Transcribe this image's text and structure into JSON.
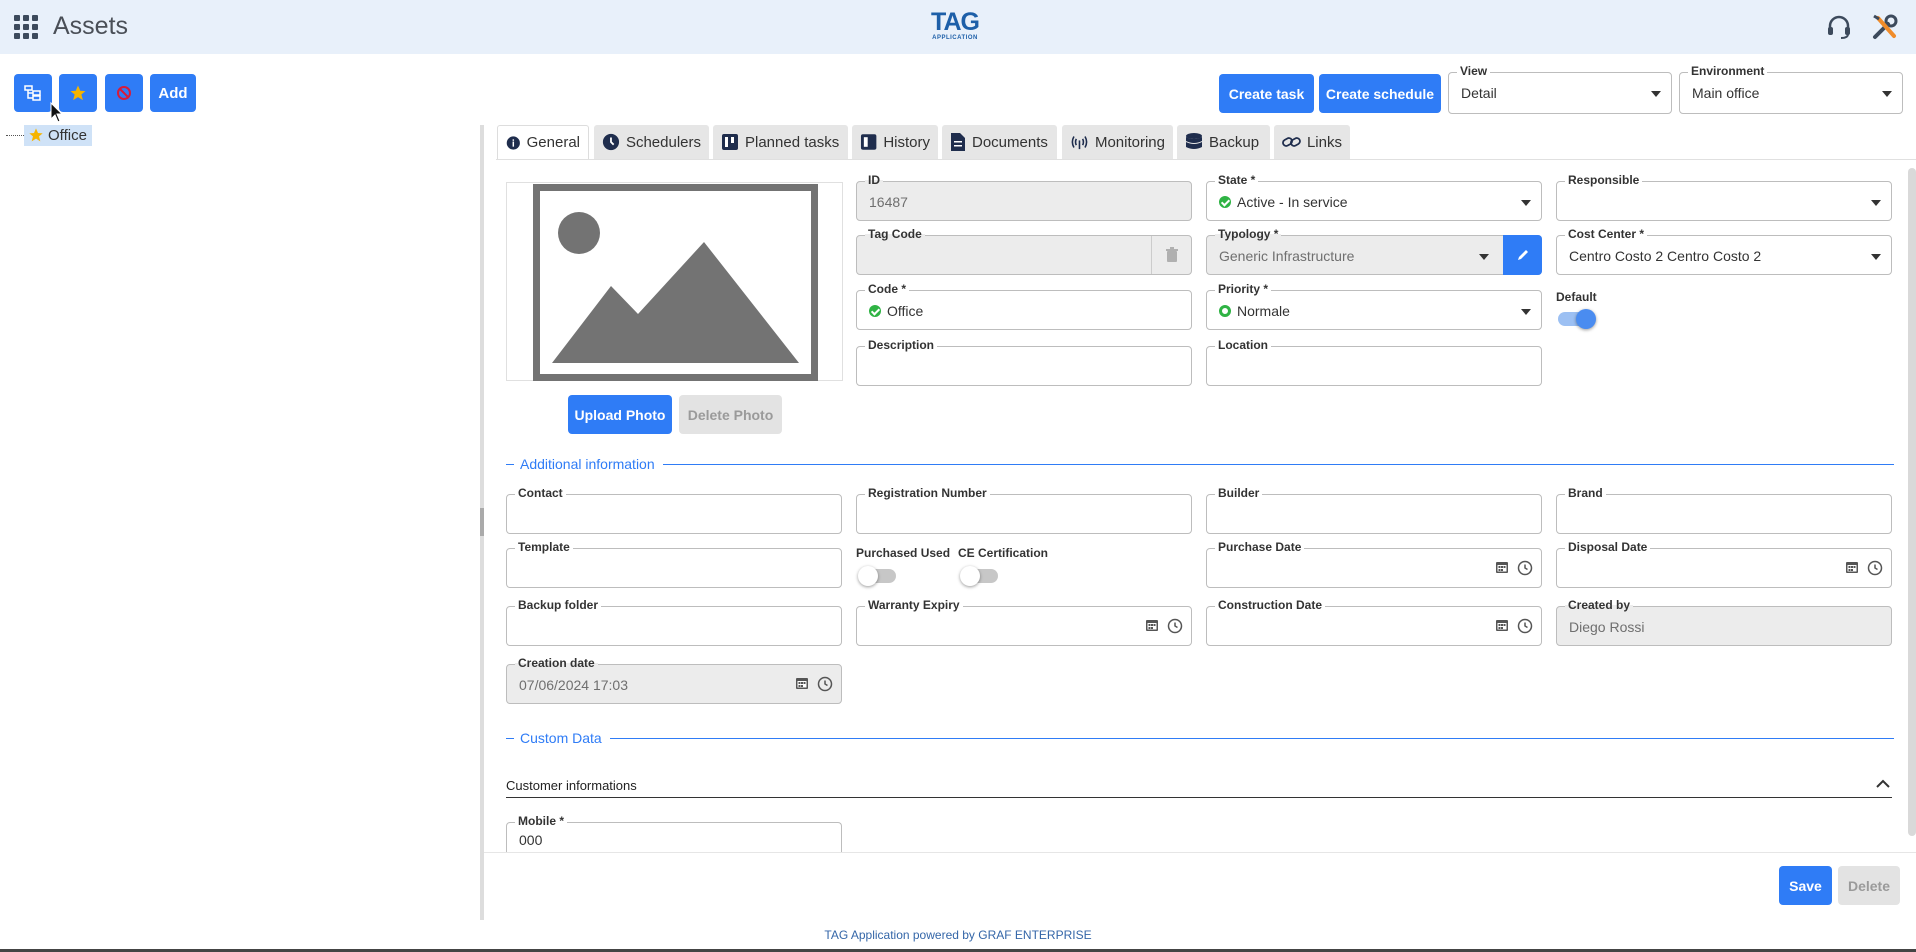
{
  "header": {
    "title": "Assets",
    "logo_big": "TAG",
    "logo_small": "APPLICATION"
  },
  "left_toolbar": {
    "add_label": "Add"
  },
  "tree": {
    "items": [
      {
        "label": "Office"
      }
    ]
  },
  "actions": {
    "create_task": "Create task",
    "create_schedule": "Create schedule",
    "view": {
      "label": "View",
      "value": "Detail"
    },
    "environment": {
      "label": "Environment",
      "value": "Main office"
    }
  },
  "tabs": [
    {
      "label": "General"
    },
    {
      "label": "Schedulers"
    },
    {
      "label": "Planned tasks"
    },
    {
      "label": "History"
    },
    {
      "label": "Documents"
    },
    {
      "label": "Monitoring"
    },
    {
      "label": "Backup"
    },
    {
      "label": "Links"
    }
  ],
  "photo": {
    "upload": "Upload Photo",
    "delete": "Delete Photo"
  },
  "general": {
    "id": {
      "label": "ID",
      "value": "16487"
    },
    "state": {
      "label": "State *",
      "value": "Active - In service"
    },
    "responsible": {
      "label": "Responsible",
      "value": ""
    },
    "tag_code": {
      "label": "Tag Code",
      "value": ""
    },
    "typology": {
      "label": "Typology *",
      "value": "Generic Infrastructure"
    },
    "cost_center": {
      "label": "Cost Center *",
      "value": "Centro Costo 2 Centro Costo 2"
    },
    "code": {
      "label": "Code *",
      "value": "Office"
    },
    "priority": {
      "label": "Priority *",
      "value": "Normale"
    },
    "default": {
      "label": "Default",
      "on": true
    },
    "description": {
      "label": "Description",
      "value": ""
    },
    "location": {
      "label": "Location",
      "value": ""
    }
  },
  "additional": {
    "title": "Additional information",
    "contact": {
      "label": "Contact"
    },
    "registration": {
      "label": "Registration Number"
    },
    "builder": {
      "label": "Builder"
    },
    "brand": {
      "label": "Brand"
    },
    "template": {
      "label": "Template"
    },
    "purchased_used": {
      "label": "Purchased Used",
      "on": false
    },
    "ce_cert": {
      "label": "CE Certification",
      "on": false
    },
    "purchase_date": {
      "label": "Purchase Date"
    },
    "disposal_date": {
      "label": "Disposal Date"
    },
    "backup_folder": {
      "label": "Backup folder"
    },
    "warranty": {
      "label": "Warranty Expiry"
    },
    "construction": {
      "label": "Construction Date"
    },
    "created_by": {
      "label": "Created by",
      "value": "Diego Rossi"
    },
    "creation_date": {
      "label": "Creation date",
      "value": "07/06/2024 17:03"
    }
  },
  "custom": {
    "title": "Custom Data",
    "group_title": "Customer informations",
    "mobile": {
      "label": "Mobile *",
      "value": "000"
    }
  },
  "bottom": {
    "save": "Save",
    "delete": "Delete"
  },
  "footer": "TAG Application powered by GRAF ENTERPRISE",
  "colors": {
    "accent": "#2f7cf6",
    "ok": "#2fb344",
    "topbar": "#e8f0fa"
  }
}
